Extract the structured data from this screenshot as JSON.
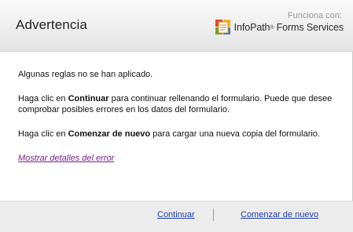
{
  "dialog": {
    "title": "Advertencia",
    "powered_by_label": "Funciona con:",
    "brand": {
      "name": "InfoPath",
      "tm": "®",
      "suffix": "Forms Services",
      "icon": "infopath-logo-icon"
    }
  },
  "message": {
    "line1": "Algunas reglas no se han aplicado.",
    "para2_before": "Haga clic en ",
    "para2_bold": "Continuar",
    "para2_after": " para continuar rellenando el formulario. Puede que desee comprobar posibles errores en los datos del formulario.",
    "para3_before": "Haga clic en ",
    "para3_bold": "Comenzar de nuevo",
    "para3_after": " para cargar una nueva copia del formulario.",
    "details_link": "Mostrar detalles del error"
  },
  "footer": {
    "continue_label": "Continuar",
    "restart_label": "Comenzar de nuevo"
  },
  "colors": {
    "link_visited": "#7a1f8c",
    "link": "#1f3ea8",
    "header_bg": "#eeeeee",
    "footer_bg": "#ececec"
  }
}
